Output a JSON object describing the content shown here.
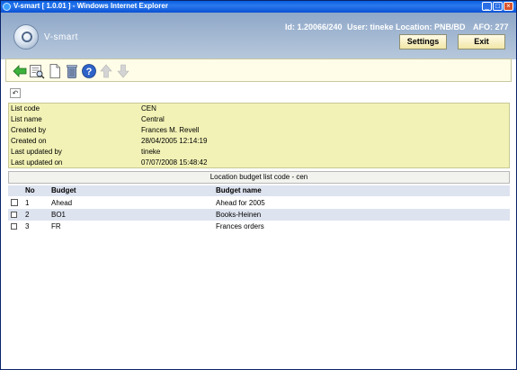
{
  "window": {
    "title": "V-smart [ 1.0.01 ] - Windows Internet Explorer",
    "min": "_",
    "max": "□",
    "close": "×"
  },
  "header": {
    "logo_text": "V-smart",
    "id": "Id: 1.20066/240",
    "user": "User: tineke",
    "location": "Location: PNB/BD",
    "afo": "AFO: 277",
    "settings_label": "Settings",
    "exit_label": "Exit"
  },
  "toolbar": {
    "icons": [
      "back-arrow-icon",
      "view-details-icon",
      "new-document-icon",
      "delete-trash-icon",
      "help-icon",
      "move-up-icon",
      "move-down-icon"
    ],
    "undo": "↶"
  },
  "info": [
    {
      "label": "List code",
      "value": "CEN"
    },
    {
      "label": "List name",
      "value": "Central"
    },
    {
      "label": "Created by",
      "value": "Frances M. Revell"
    },
    {
      "label": "Created on",
      "value": "28/04/2005 12:14:19"
    },
    {
      "label": "Last updated by",
      "value": "tineke"
    },
    {
      "label": "Last updated on",
      "value": "07/07/2008 15:48:42"
    }
  ],
  "section_title": "Location budget list code - cen",
  "table": {
    "columns": [
      "No",
      "Budget",
      "Budget name"
    ],
    "rows": [
      {
        "no": "1",
        "budget": "Ahead",
        "name": "Ahead for 2005"
      },
      {
        "no": "2",
        "budget": "BO1",
        "name": "Books-Heinen"
      },
      {
        "no": "3",
        "budget": "FR",
        "name": "Frances orders"
      }
    ]
  },
  "colors": {
    "panel": "#f2f2b6",
    "row_alt": "#dde3ef",
    "header_band": "#8fa8c8"
  }
}
